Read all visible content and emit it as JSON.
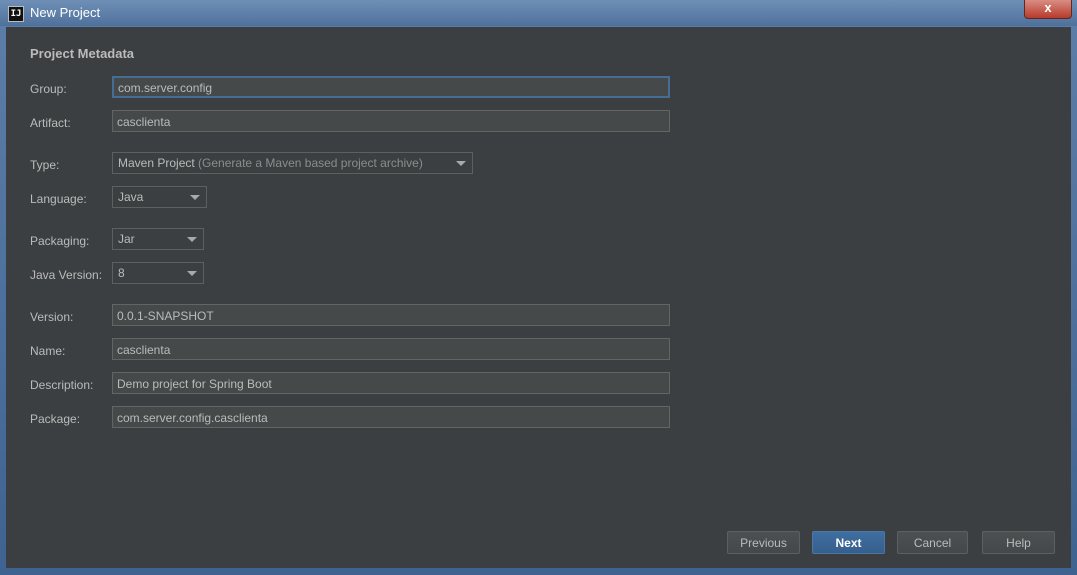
{
  "window": {
    "title": "New Project",
    "app_icon": "IJ",
    "close_label": "x"
  },
  "section": {
    "heading": "Project Metadata"
  },
  "fields": {
    "group": {
      "label": "Group:",
      "value": "com.server.config"
    },
    "artifact": {
      "label": "Artifact:",
      "value": "casclienta"
    },
    "type": {
      "label": "Type:",
      "value": "Maven Project",
      "hint": "(Generate a Maven based project archive)"
    },
    "language": {
      "label": "Language:",
      "value": "Java"
    },
    "packaging": {
      "label": "Packaging:",
      "value": "Jar"
    },
    "java_version": {
      "label": "Java Version:",
      "value": "8"
    },
    "version": {
      "label": "Version:",
      "value": "0.0.1-SNAPSHOT"
    },
    "name": {
      "label": "Name:",
      "value": "casclienta"
    },
    "description": {
      "label": "Description:",
      "value": "Demo project for Spring Boot"
    },
    "package": {
      "label": "Package:",
      "value": "com.server.config.casclienta"
    }
  },
  "buttons": {
    "previous": "Previous",
    "next": "Next",
    "cancel": "Cancel",
    "help": "Help"
  }
}
